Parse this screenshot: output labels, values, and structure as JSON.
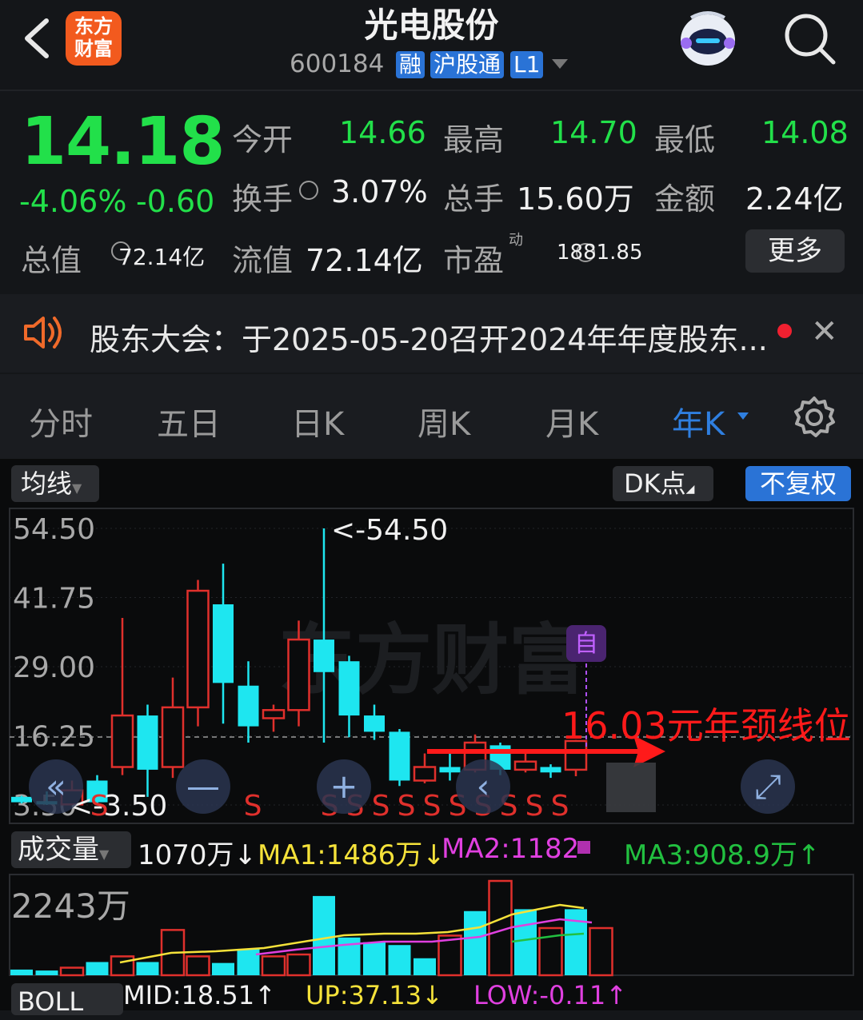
{
  "header": {
    "logo_line1": "东方",
    "logo_line2": "财富",
    "title": "光电股份",
    "code": "600184",
    "tags": [
      "融",
      "沪股通",
      "L1"
    ]
  },
  "quote": {
    "price": "14.18",
    "change_pct": "-4.06%",
    "change": "-0.60",
    "open_label": "今开",
    "open": "14.66",
    "high_label": "最高",
    "high": "14.70",
    "low_label": "最低",
    "low": "14.08",
    "turnover_label": "换手",
    "turnover": "3.07%",
    "volume_label": "总手",
    "volume": "15.60万",
    "amount_label": "金额",
    "amount": "2.24亿",
    "mktcap_label": "总值",
    "mktcap": "72.14亿",
    "float_label": "流值",
    "float": "72.14亿",
    "pe_label": "市盈",
    "pe_sup": "动",
    "pe": "1881.85",
    "more": "更多"
  },
  "notice": {
    "text": "股东大会：于2025-05-20召开2024年年度股东..."
  },
  "tabs": [
    "分时",
    "五日",
    "日K",
    "周K",
    "月K",
    "年K"
  ],
  "active_tab": "年K",
  "chart_controls": {
    "ma_label": "均线",
    "dk_label": "DK点",
    "adjust_label": "不复权",
    "auto_label": "自"
  },
  "chart_data": {
    "type": "candlestick",
    "y_ticks": [
      "54.50",
      "41.75",
      "29.00",
      "16.25",
      "3.50"
    ],
    "ylim": [
      3.5,
      54.5
    ],
    "max_marker": "<-54.50",
    "min_marker": "<-3.50",
    "annotation": "16.03元年颈线位",
    "neckline": 16.03,
    "signal_marks": "S",
    "candles": [
      {
        "o": 5.0,
        "c": 4.0,
        "h": 5.2,
        "l": 3.8
      },
      {
        "o": 4.2,
        "c": 3.6,
        "h": 6.0,
        "l": 3.5
      },
      {
        "o": 3.6,
        "c": 6.2,
        "h": 8.0,
        "l": 3.5
      },
      {
        "o": 8.0,
        "c": 4.0,
        "h": 9.0,
        "l": 3.8
      },
      {
        "o": 10.5,
        "c": 20.0,
        "h": 38.0,
        "l": 9.0
      },
      {
        "o": 20.0,
        "c": 10.0,
        "h": 22.0,
        "l": 5.0
      },
      {
        "o": 10.5,
        "c": 21.5,
        "h": 27.0,
        "l": 8.5
      },
      {
        "o": 21.5,
        "c": 43.0,
        "h": 45.0,
        "l": 18.0
      },
      {
        "o": 40.5,
        "c": 26.0,
        "h": 48.0,
        "l": 18.5
      },
      {
        "o": 25.5,
        "c": 18.0,
        "h": 30.0,
        "l": 15.0
      },
      {
        "o": 19.5,
        "c": 21.0,
        "h": 22.0,
        "l": 17.0
      },
      {
        "o": 21.0,
        "c": 34.0,
        "h": 37.5,
        "l": 18.0
      },
      {
        "o": 34.0,
        "c": 28.0,
        "h": 54.5,
        "l": 15.0
      },
      {
        "o": 30.0,
        "c": 20.0,
        "h": 31.0,
        "l": 16.0
      },
      {
        "o": 20.0,
        "c": 17.0,
        "h": 22.0,
        "l": 15.5
      },
      {
        "o": 17.0,
        "c": 8.0,
        "h": 17.5,
        "l": 7.0
      },
      {
        "o": 8.0,
        "c": 10.5,
        "h": 13.0,
        "l": 7.5
      },
      {
        "o": 10.5,
        "c": 9.5,
        "h": 13.0,
        "l": 8.0
      },
      {
        "o": 10.0,
        "c": 15.0,
        "h": 16.5,
        "l": 9.5
      },
      {
        "o": 14.5,
        "c": 10.0,
        "h": 15.0,
        "l": 9.0
      },
      {
        "o": 10.0,
        "c": 11.5,
        "h": 13.0,
        "l": 9.5
      },
      {
        "o": 10.5,
        "c": 9.5,
        "h": 11.0,
        "l": 8.5
      },
      {
        "o": 10.0,
        "c": 15.3,
        "h": 15.5,
        "l": 8.8
      }
    ]
  },
  "volume": {
    "label": "成交量",
    "current": "1070万",
    "ma1": "MA1:1486万",
    "ma2": "MA2:1182",
    "ma3": "MA3:908.9万",
    "max_label": "2243万",
    "bars": [
      {
        "v": 0.06,
        "up": false
      },
      {
        "v": 0.05,
        "up": false
      },
      {
        "v": 0.08,
        "up": true
      },
      {
        "v": 0.14,
        "up": false
      },
      {
        "v": 0.2,
        "up": true
      },
      {
        "v": 0.14,
        "up": false
      },
      {
        "v": 0.48,
        "up": true
      },
      {
        "v": 0.2,
        "up": true
      },
      {
        "v": 0.13,
        "up": false
      },
      {
        "v": 0.28,
        "up": false
      },
      {
        "v": 0.2,
        "up": true
      },
      {
        "v": 0.22,
        "up": true
      },
      {
        "v": 0.84,
        "up": false
      },
      {
        "v": 0.4,
        "up": false
      },
      {
        "v": 0.35,
        "up": false
      },
      {
        "v": 0.32,
        "up": false
      },
      {
        "v": 0.18,
        "up": false
      },
      {
        "v": 0.42,
        "up": true
      },
      {
        "v": 0.68,
        "up": false
      },
      {
        "v": 1.0,
        "up": true
      },
      {
        "v": 0.7,
        "up": false
      },
      {
        "v": 0.5,
        "up": true
      },
      {
        "v": 0.7,
        "up": false
      },
      {
        "v": 0.5,
        "up": true
      }
    ]
  },
  "boll": {
    "label": "BOLL",
    "mid": "MID:18.51",
    "up": "UP:37.13",
    "low": "LOW:-0.11"
  },
  "colors": {
    "up": "#e0302c",
    "down": "#1ee6f0",
    "green_text": "#22e04a",
    "accent": "#2a73d6",
    "annotation": "#ff1a1a"
  }
}
